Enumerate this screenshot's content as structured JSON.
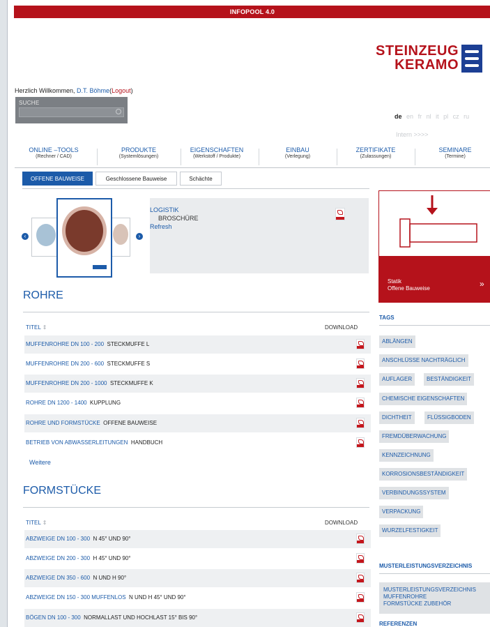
{
  "header": {
    "title": "INFOPOOL 4.0",
    "logo_line1": "STEINZEUG",
    "logo_line2": "KERAMO",
    "brand_color": "#b5121b",
    "accent_color": "#1c5ba9"
  },
  "welcome": {
    "prefix": "Herzlich Willkommen,",
    "user": "D.T. Böhme",
    "open": "(",
    "logout": "Logout",
    "close": ")"
  },
  "search": {
    "label": "SUCHE",
    "placeholder": "",
    "icon": "search-icon"
  },
  "languages": {
    "items": [
      "de",
      "en",
      "fr",
      "nl",
      "it",
      "pl",
      "cz",
      "ru"
    ],
    "active": "de"
  },
  "intern": "Intern >>>>",
  "nav": [
    {
      "label": "ONLINE –TOOLS",
      "sub": "(Rechner / CAD)"
    },
    {
      "label": "PRODUKTE",
      "sub": "(Systemlösungen)"
    },
    {
      "label": "EIGENSCHAFTEN",
      "sub": "(Werkstoff / Produkte)"
    },
    {
      "label": "EINBAU",
      "sub": "(Verlegung)"
    },
    {
      "label": "ZERTIFIKATE",
      "sub": "(Zulassungen)"
    },
    {
      "label": "SEMINARE",
      "sub": "(Termine)"
    }
  ],
  "tabs": [
    "OFFENE BAUWEISE",
    "Geschlossene Bauweise",
    "Schächte"
  ],
  "feature": {
    "title": "LOGISTIK",
    "type": "BROSCHÜRE",
    "refresh": "Refresh"
  },
  "statik": {
    "line1": "Statik",
    "line2": "Offene Bauweise",
    "arrow": "»"
  },
  "rohre": {
    "title": "ROHRE",
    "col_title": "TITEL",
    "col_download": "DOWNLOAD",
    "rows": [
      {
        "a": "MUFFENROHRE DN 100 - 200",
        "b": "STECKMUFFE L"
      },
      {
        "a": "MUFFENROHRE DN 200 - 600",
        "b": "STECKMUFFE S"
      },
      {
        "a": "MUFFENROHRE DN 200 - 1000",
        "b": "STECKMUFFE K"
      },
      {
        "a": "ROHRE DN 1200 - 1400",
        "b": "KUPPLUNG"
      },
      {
        "a": "ROHRE UND FORMSTÜCKE",
        "b": "OFFENE BAUWEISE"
      },
      {
        "a": "BETRIEB VON ABWASSERLEITUNGEN",
        "b": "HANDBUCH"
      }
    ],
    "more": "Weitere"
  },
  "formstuecke": {
    "title": "FORMSTÜCKE",
    "col_title": "TITEL",
    "col_download": "DOWNLOAD",
    "rows": [
      {
        "a": "ABZWEIGE DN 100 - 300",
        "b": "N 45° UND 90°"
      },
      {
        "a": "ABZWEIGE DN 200 - 300",
        "b": "H 45° UND 90°"
      },
      {
        "a": "ABZWEIGE DN 350 - 600",
        "b": "N UND H 90°"
      },
      {
        "a": "ABZWEIGE DN 150 - 300 MUFFENLOS",
        "b": "N UND H 45° UND 90°"
      },
      {
        "a": "BÖGEN DN 100 - 300",
        "b": "NORMALLAST UND HOCHLAST 15° BIS 90°"
      }
    ]
  },
  "tags": {
    "title": "TAGS",
    "items": [
      "ABLÄNGEN",
      "ANSCHLÜSSE NACHTRÄGLICH",
      "AUFLAGER",
      "BESTÄNDIGKEIT",
      "CHEMISCHE EIGENSCHAFTEN",
      "DICHTHEIT",
      "FLÜSSIGBODEN",
      "FREMDÜBERWACHUNG",
      "KENNZEICHNUNG",
      "KORROSIONSBESTÄNDIGKEIT",
      "VERBINDUNGSSYSTEM",
      "VERPACKUNG",
      "WURZELFESTIGKEIT"
    ]
  },
  "mlv": {
    "title": "MUSTERLEISTUNGSVERZEICHNIS",
    "item_l1": "MUSTERLEISTUNGSVERZEICHNIS",
    "item_l2": "MUFFENROHRE",
    "item_l3": "FORMSTÜCKE ZUBEHÖR"
  },
  "referenzen": {
    "title": "REFERENZEN"
  }
}
